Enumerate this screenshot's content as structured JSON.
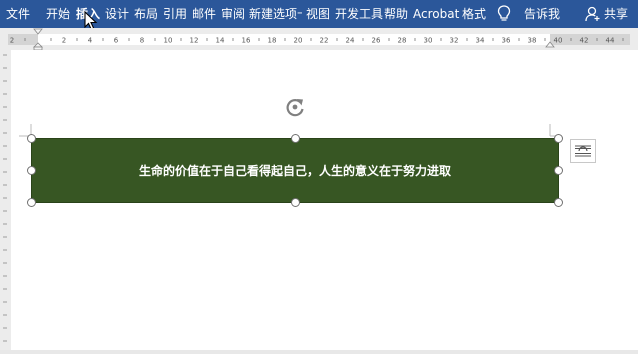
{
  "ribbon": {
    "tabs": [
      "文件",
      "开始",
      "插入",
      "设计",
      "布局",
      "引用",
      "邮件",
      "审阅",
      "新建选项卡",
      "视图",
      "开发工具",
      "帮助",
      "Acrobat",
      "格式"
    ],
    "selected_tab": "插入",
    "tell_me": "告诉我",
    "share": "共享",
    "background_color": "#2b579a"
  },
  "ruler": {
    "labels": [
      "2",
      "2",
      "4",
      "6",
      "8",
      "10",
      "12",
      "14",
      "16",
      "18",
      "20",
      "22",
      "24",
      "26",
      "28",
      "30",
      "32",
      "34",
      "36",
      "38",
      "40",
      "42",
      "44"
    ]
  },
  "document": {
    "shape_text": "生命的价值在于自己看得起自己，人生的意义在于努力进取",
    "shape_fill": "#375623"
  },
  "icons": {
    "tell_me": "lightbulb-icon",
    "share": "person-icon",
    "rotate": "rotate-handle-icon",
    "layout_options": "layout-options-icon",
    "cursor": "mouse-cursor-icon"
  }
}
